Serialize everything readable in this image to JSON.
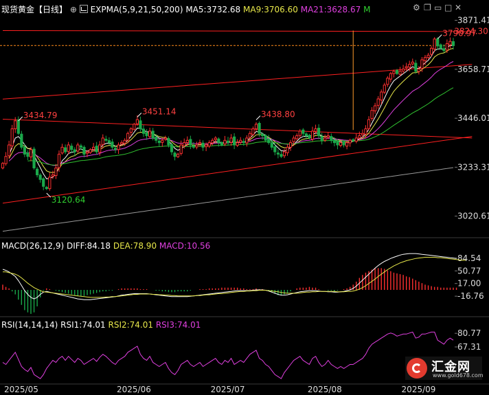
{
  "header": {
    "instrument": "现货黄金【日线】",
    "tool_icon": "⊕",
    "indicator_icon": "chart-indicator-icon",
    "expma": "EXPMA(5,9,21,50,200)",
    "ma5": "MA5:3732.68",
    "ma9": "MA9:3706.60",
    "ma21": "MA21:3628.67",
    "more": "M"
  },
  "toolbar": {
    "icons": [
      "settings-icon",
      "restore-icon",
      "minimize-icon",
      "maximize-icon",
      "close-icon"
    ]
  },
  "macd_header": {
    "name": "MACD(26,12,9)",
    "diff": "DIFF:84.18",
    "dea": "DEA:78.90",
    "macd": "MACD:10.56"
  },
  "rsi_header": {
    "name": "RSI(14,14,14)",
    "rsi1": "RSI1:74.01",
    "rsi2": "RSI2:74.01",
    "rsi3": "RSI3:74.01"
  },
  "colors": {
    "up": "#ff3030",
    "down": "#1aa84a",
    "ma5": "#ffffff",
    "ma9": "#e8e84a",
    "ma21": "#e040e0",
    "ma50": "#30c030",
    "ma200": "#999999",
    "trend": "#ff2020",
    "vline": "#ff9a2a",
    "text_white": "#ffffff",
    "text_yellow": "#e8e84a",
    "text_magenta": "#e040e0",
    "text_green": "#30d030",
    "axis_text": "#dddddd"
  },
  "logo": {
    "name": "汇金网",
    "url": "www.gold678.com"
  },
  "chart_data": {
    "price_panel": {
      "type": "candlestick",
      "y_ticks": [
        3871.41,
        3658.71,
        3446.01,
        3233.31,
        3020.61
      ],
      "ylim": [
        2930,
        3900
      ],
      "x_labels": [
        "2025/05",
        "2025/06",
        "2025/07",
        "2025/08",
        "2025/09"
      ],
      "annotations": [
        {
          "label": "3434.79",
          "x_index": 5,
          "y": 3434.79
        },
        {
          "label": "3120.64",
          "x_index": 14,
          "y": 3120.64
        },
        {
          "label": "3451.14",
          "x_index": 43,
          "y": 3451.14
        },
        {
          "label": "3438.80",
          "x_index": 81,
          "y": 3438.8
        },
        {
          "label": "3790.97",
          "x_index": 139,
          "y": 3790.97
        },
        {
          "label": "3824.30",
          "x_index": 144,
          "y": 3824.3
        }
      ],
      "current_price_line": 3762,
      "price_box_label": "3824.30",
      "closes": [
        3250,
        3280,
        3330,
        3400,
        3435,
        3380,
        3320,
        3290,
        3280,
        3310,
        3230,
        3200,
        3180,
        3150,
        3140,
        3190,
        3200,
        3230,
        3290,
        3320,
        3300,
        3330,
        3310,
        3300,
        3330,
        3320,
        3290,
        3300,
        3310,
        3320,
        3300,
        3330,
        3360,
        3350,
        3340,
        3320,
        3310,
        3330,
        3340,
        3350,
        3380,
        3400,
        3420,
        3440,
        3400,
        3380,
        3370,
        3390,
        3360,
        3350,
        3340,
        3350,
        3360,
        3330,
        3300,
        3280,
        3290,
        3330,
        3340,
        3350,
        3330,
        3320,
        3330,
        3340,
        3320,
        3330,
        3340,
        3350,
        3360,
        3340,
        3330,
        3350,
        3340,
        3360,
        3330,
        3340,
        3350,
        3340,
        3360,
        3380,
        3400,
        3420,
        3380,
        3370,
        3350,
        3340,
        3320,
        3300,
        3290,
        3280,
        3300,
        3320,
        3340,
        3360,
        3370,
        3390,
        3380,
        3370,
        3360,
        3390,
        3400,
        3370,
        3350,
        3360,
        3370,
        3350,
        3340,
        3330,
        3340,
        3330,
        3340,
        3350,
        3350,
        3360,
        3370,
        3380,
        3400,
        3440,
        3480,
        3500,
        3530,
        3560,
        3590,
        3620,
        3640,
        3650,
        3640,
        3650,
        3660,
        3670,
        3680,
        3690,
        3650,
        3660,
        3700,
        3710,
        3720,
        3750,
        3790,
        3760,
        3750,
        3740,
        3770,
        3780,
        3762
      ],
      "trendlines": [
        {
          "from": [
            0,
            3529
          ],
          "to": [
            150,
            3680
          ]
        },
        {
          "from": [
            0,
            3442
          ],
          "to": [
            150,
            3360
          ]
        },
        {
          "from": [
            0,
            3077
          ],
          "to": [
            150,
            3367
          ]
        },
        {
          "from": [
            0,
            3827
          ],
          "to": [
            150,
            3823
          ]
        }
      ],
      "vertical_marker_index": 112
    },
    "macd_panel": {
      "type": "line",
      "y_ticks": [
        84.54,
        50.77,
        17.0,
        -16.76
      ],
      "ylim": [
        -55,
        110
      ],
      "diff": [
        55,
        52,
        48,
        42,
        36,
        25,
        12,
        -2,
        -12,
        -20,
        -24,
        -20,
        -12,
        -6,
        -4,
        -6,
        -8,
        -10,
        -12,
        -14,
        -16,
        -18,
        -20,
        -22,
        -24,
        -25,
        -26,
        -26,
        -26,
        -25,
        -24,
        -23,
        -22,
        -21,
        -20,
        -19,
        -18,
        -16,
        -14,
        -13,
        -12,
        -11,
        -10,
        -10,
        -10,
        -10,
        -10,
        -11,
        -12,
        -13,
        -14,
        -15,
        -16,
        -17,
        -18,
        -18,
        -18,
        -18,
        -18,
        -18,
        -17,
        -16,
        -15,
        -14,
        -13,
        -12,
        -11,
        -10,
        -9,
        -8,
        -7,
        -6,
        -5,
        -4,
        -3,
        -2,
        -2,
        -2,
        -2,
        -2,
        -1,
        0,
        0,
        0,
        -1,
        -3,
        -6,
        -9,
        -12,
        -14,
        -14,
        -13,
        -11,
        -9,
        -7,
        -5,
        -4,
        -3,
        -2,
        -2,
        -2,
        -3,
        -4,
        -4,
        -5,
        -5,
        -6,
        -6,
        -5,
        -4,
        -2,
        0,
        4,
        10,
        18,
        26,
        34,
        42,
        50,
        58,
        65,
        71,
        76,
        80,
        84,
        87,
        90,
        93,
        95,
        96,
        97,
        97,
        97,
        96,
        95,
        94,
        93,
        92,
        91,
        90,
        89,
        88,
        87,
        86,
        85,
        84
      ],
      "dea": [
        48,
        48,
        46,
        44,
        42,
        38,
        32,
        25,
        18,
        12,
        6,
        2,
        -2,
        -5,
        -6,
        -7,
        -8,
        -9,
        -10,
        -11,
        -12,
        -13,
        -14,
        -15,
        -16,
        -17,
        -18,
        -19,
        -20,
        -20,
        -20,
        -20,
        -20,
        -19,
        -19,
        -18,
        -18,
        -17,
        -16,
        -15,
        -14,
        -13,
        -12,
        -12,
        -11,
        -11,
        -11,
        -11,
        -12,
        -12,
        -13,
        -13,
        -14,
        -14,
        -15,
        -15,
        -16,
        -16,
        -16,
        -16,
        -16,
        -16,
        -15,
        -15,
        -14,
        -13,
        -13,
        -12,
        -11,
        -10,
        -10,
        -9,
        -8,
        -7,
        -6,
        -5,
        -4,
        -4,
        -3,
        -3,
        -2,
        -2,
        -1,
        -1,
        -1,
        -2,
        -3,
        -4,
        -5,
        -7,
        -8,
        -9,
        -9,
        -9,
        -9,
        -8,
        -7,
        -6,
        -6,
        -5,
        -5,
        -4,
        -4,
        -4,
        -4,
        -4,
        -4,
        -5,
        -5,
        -5,
        -4,
        -4,
        -3,
        -1,
        2,
        6,
        11,
        17,
        23,
        29,
        36,
        42,
        48,
        54,
        59,
        64,
        68,
        72,
        75,
        78,
        80,
        82,
        84,
        85,
        86,
        87,
        87,
        87,
        87,
        86,
        86,
        85,
        84,
        83,
        82,
        81,
        80,
        79,
        79
      ]
    },
    "rsi_panel": {
      "type": "line",
      "y_ticks": [
        80.77,
        67.31
      ],
      "ylim": [
        30,
        87
      ],
      "rsi": [
        52,
        50,
        54,
        58,
        62,
        55,
        48,
        45,
        43,
        47,
        40,
        38,
        36,
        40,
        46,
        50,
        54,
        52,
        56,
        58,
        54,
        58,
        55,
        52,
        56,
        54,
        50,
        52,
        54,
        56,
        53,
        57,
        60,
        58,
        55,
        52,
        50,
        54,
        56,
        58,
        62,
        64,
        66,
        68,
        60,
        56,
        54,
        58,
        52,
        50,
        48,
        50,
        52,
        46,
        42,
        40,
        44,
        50,
        52,
        54,
        50,
        48,
        50,
        52,
        48,
        50,
        52,
        54,
        56,
        52,
        50,
        54,
        52,
        56,
        50,
        52,
        54,
        52,
        56,
        60,
        62,
        64,
        56,
        54,
        50,
        48,
        44,
        40,
        38,
        36,
        42,
        46,
        50,
        54,
        56,
        58,
        54,
        52,
        50,
        56,
        58,
        52,
        48,
        50,
        54,
        50,
        48,
        46,
        48,
        46,
        48,
        50,
        50,
        52,
        54,
        56,
        60,
        66,
        70,
        72,
        74,
        76,
        78,
        80,
        81,
        80,
        78,
        79,
        80,
        80,
        81,
        82,
        76,
        77,
        80,
        80,
        81,
        82,
        82,
        74,
        72,
        70,
        74,
        76,
        74
      ]
    }
  }
}
